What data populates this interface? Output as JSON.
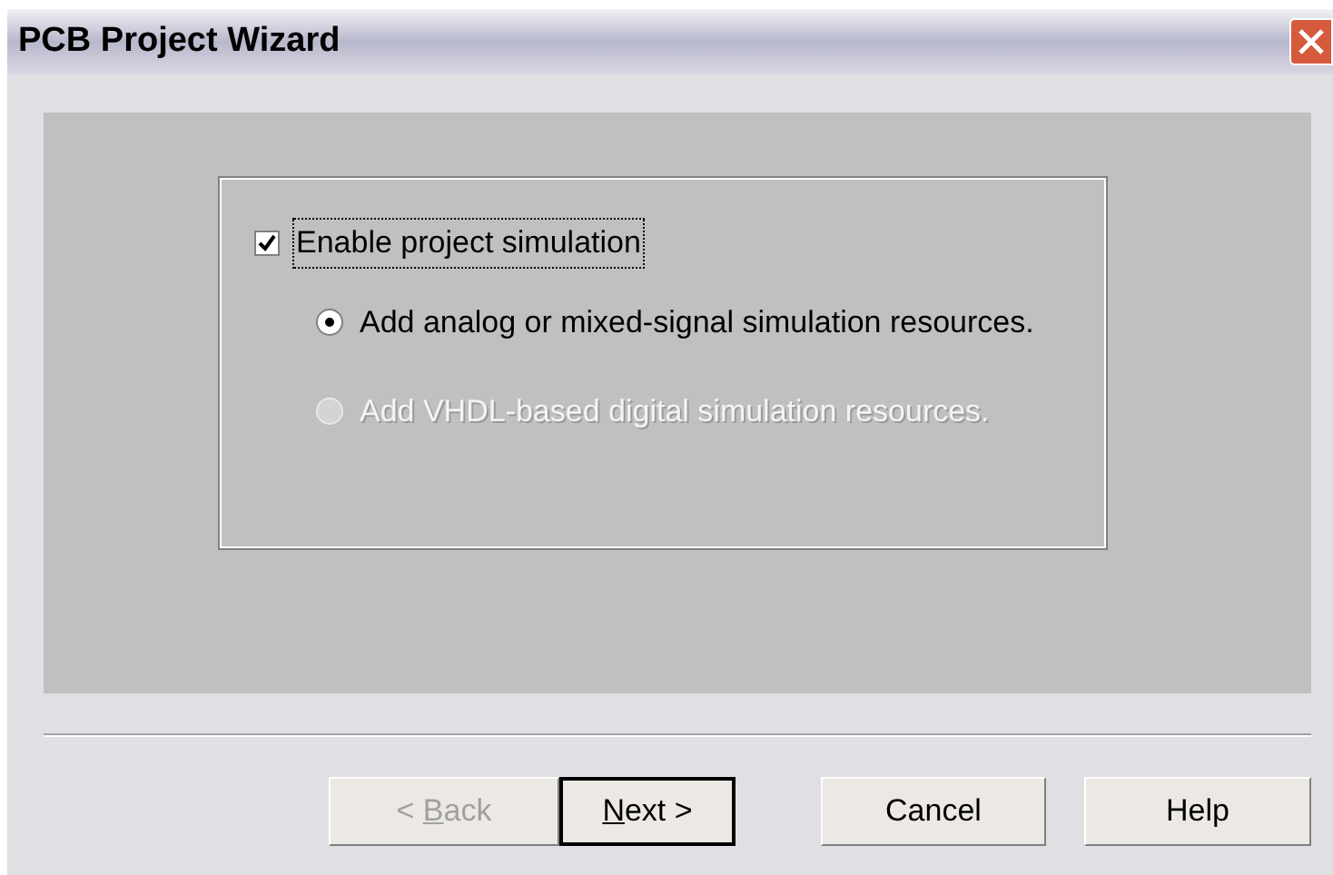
{
  "window": {
    "title": "PCB Project Wizard"
  },
  "simulation": {
    "label": "Enable project simulation",
    "checked": true,
    "focused": true
  },
  "options": [
    {
      "label": "Add analog or mixed-signal simulation resources.",
      "selected": true,
      "disabled": false
    },
    {
      "label": "Add VHDL-based digital simulation resources.",
      "selected": false,
      "disabled": true
    }
  ],
  "buttons": [
    {
      "before": "< ",
      "key": "B",
      "after": "ack",
      "disabled": true,
      "default": false
    },
    {
      "key": "N",
      "after": "ext >",
      "disabled": false,
      "default": true
    },
    {
      "before": "Cancel",
      "disabled": false,
      "default": false
    },
    {
      "before": "Help",
      "disabled": false,
      "default": false
    }
  ]
}
